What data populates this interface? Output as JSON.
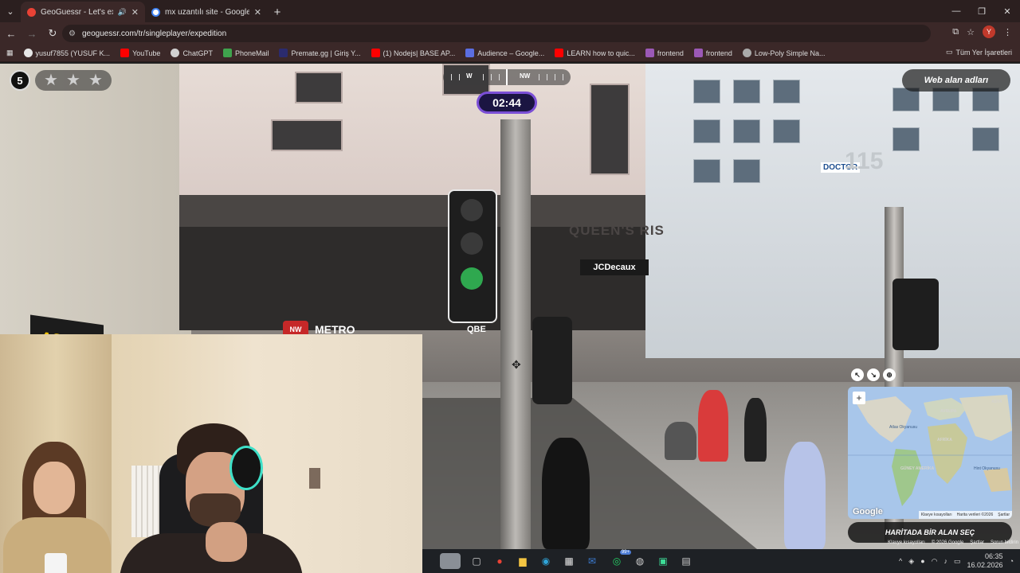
{
  "browser": {
    "tabs": [
      {
        "title": "GeoGuessr - Let's explore th",
        "active": true,
        "audio": true
      },
      {
        "title": "mx uzantılı site - Google'da Ara",
        "active": false,
        "audio": false
      }
    ],
    "url": "geoguessr.com/tr/singleplayer/expedition",
    "profile_initial": "Y",
    "bookmarks": [
      {
        "label": "yusuf7855 (YUSUF K...",
        "icon": "github-icon",
        "color": "#e6e6e6"
      },
      {
        "label": "YouTube",
        "icon": "youtube-icon",
        "color": "#ff0000"
      },
      {
        "label": "ChatGPT",
        "icon": "chatgpt-icon",
        "color": "#d0d0d0"
      },
      {
        "label": "PhoneMail",
        "icon": "mail-icon",
        "color": "#3fa34d"
      },
      {
        "label": "Premate.gg | Giriş Y...",
        "icon": "premate-icon",
        "color": "#2b2b6e"
      },
      {
        "label": "(1) Nodejs| BASE AP...",
        "icon": "youtube-icon",
        "color": "#ff0000"
      },
      {
        "label": "Audience – Google...",
        "icon": "audience-icon",
        "color": "#5b6ee1"
      },
      {
        "label": "LEARN how to quic...",
        "icon": "youtube-icon",
        "color": "#ff0000"
      },
      {
        "label": "frontend",
        "icon": "frontend-icon",
        "color": "#9b59b6"
      },
      {
        "label": "frontend",
        "icon": "frontend-icon",
        "color": "#9b59b6"
      },
      {
        "label": "Low-Poly Simple Na...",
        "icon": "globe-icon",
        "color": "#aaaaaa"
      }
    ],
    "all_bookmarks": "Tüm Yer İşaretleri"
  },
  "game": {
    "round": "5",
    "stars": 3,
    "compass": {
      "labels": [
        "W",
        "NW"
      ]
    },
    "timer": "02:44",
    "web_alan_button": "Web alan adları",
    "guess_button": "HARİTADA BİR ALAN SEÇ",
    "accent_color": "#7b4fd6"
  },
  "street_view": {
    "signs": {
      "asb": "ASB",
      "queens": "QUEEN'S RIS",
      "jcdecaux": "JCDecaux",
      "metro": "METRO",
      "nw": "NW",
      "qbe": "QBE",
      "doctor": "DOCTOR",
      "number": "115"
    },
    "attribution": [
      "Klavye kısayolları",
      "© 2026 Google",
      "Şartlar",
      "Sorun bildirin"
    ]
  },
  "map": {
    "google_logo": "Google",
    "attribution": [
      "Klavye kısayolları",
      "Harita verileri ©2026",
      "Şartlar"
    ],
    "labels": {
      "atlas": "Atlas\nOkyanusu",
      "avrupa": "AVRUPA",
      "asya": "ASYA",
      "afrika": "AFRİKA",
      "guney": "GÜNEY\nAMERİKA",
      "hint": "Hint\nOkyanusu"
    }
  },
  "taskbar": {
    "apps": [
      {
        "name": "taskview-app",
        "glyph": "▢",
        "color": "#cfcfcf"
      },
      {
        "name": "chrome-app",
        "glyph": "●",
        "color": "#e94235"
      },
      {
        "name": "file-explorer-app",
        "glyph": "▆",
        "color": "#f4c542"
      },
      {
        "name": "edge-app",
        "glyph": "◉",
        "color": "#2fa4d8"
      },
      {
        "name": "store-app",
        "glyph": "▦",
        "color": "#e8e8e8"
      },
      {
        "name": "mail-app",
        "glyph": "✉",
        "color": "#3b7bd1"
      },
      {
        "name": "whatsapp-app",
        "glyph": "◎",
        "color": "#25d366"
      },
      {
        "name": "spotify-app",
        "glyph": "◍",
        "color": "#cfcfcf"
      },
      {
        "name": "whatsapp-desktop-app",
        "glyph": "▣",
        "color": "#3ddc97"
      },
      {
        "name": "terminal-app",
        "glyph": "▤",
        "color": "#cfcfcf"
      }
    ],
    "whatsapp_badge": "99+",
    "time": "06:35",
    "date": "16.02.2026"
  }
}
